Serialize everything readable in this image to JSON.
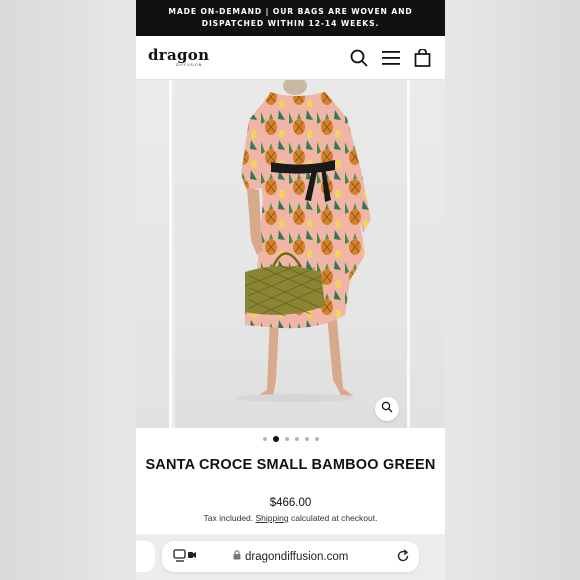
{
  "announcement": {
    "line1": "MADE ON-DEMAND | OUR BAGS ARE WOVEN AND",
    "line2": "DISPATCHED WITHIN 12-14 WEEKS."
  },
  "header": {
    "logo_text": "dragon",
    "logo_subtext": "DIFFUSION",
    "icons": [
      "search-icon",
      "menu-icon",
      "cart-icon"
    ]
  },
  "gallery": {
    "image_alt": "Model in pineapple print dress holding green woven bamboo bag",
    "slide_count": 6,
    "active_slide": 2,
    "zoom_icon": "zoom-icon"
  },
  "product": {
    "title": "SANTA CROCE SMALL BAMBOO GREEN",
    "price": "$466.00",
    "tax_prefix": "Tax included.",
    "shipping_link": "Shipping",
    "tax_suffix": "calculated at checkout."
  },
  "browser": {
    "url": "dragondiffusion.com",
    "icons": [
      "reader-icon",
      "lock-icon",
      "reload-icon"
    ]
  },
  "colors": {
    "announce_bg": "#111111",
    "dress_pink": "#f2b7a8",
    "pineapple": "#d88a2a",
    "bag_green": "#7c7a2a"
  }
}
